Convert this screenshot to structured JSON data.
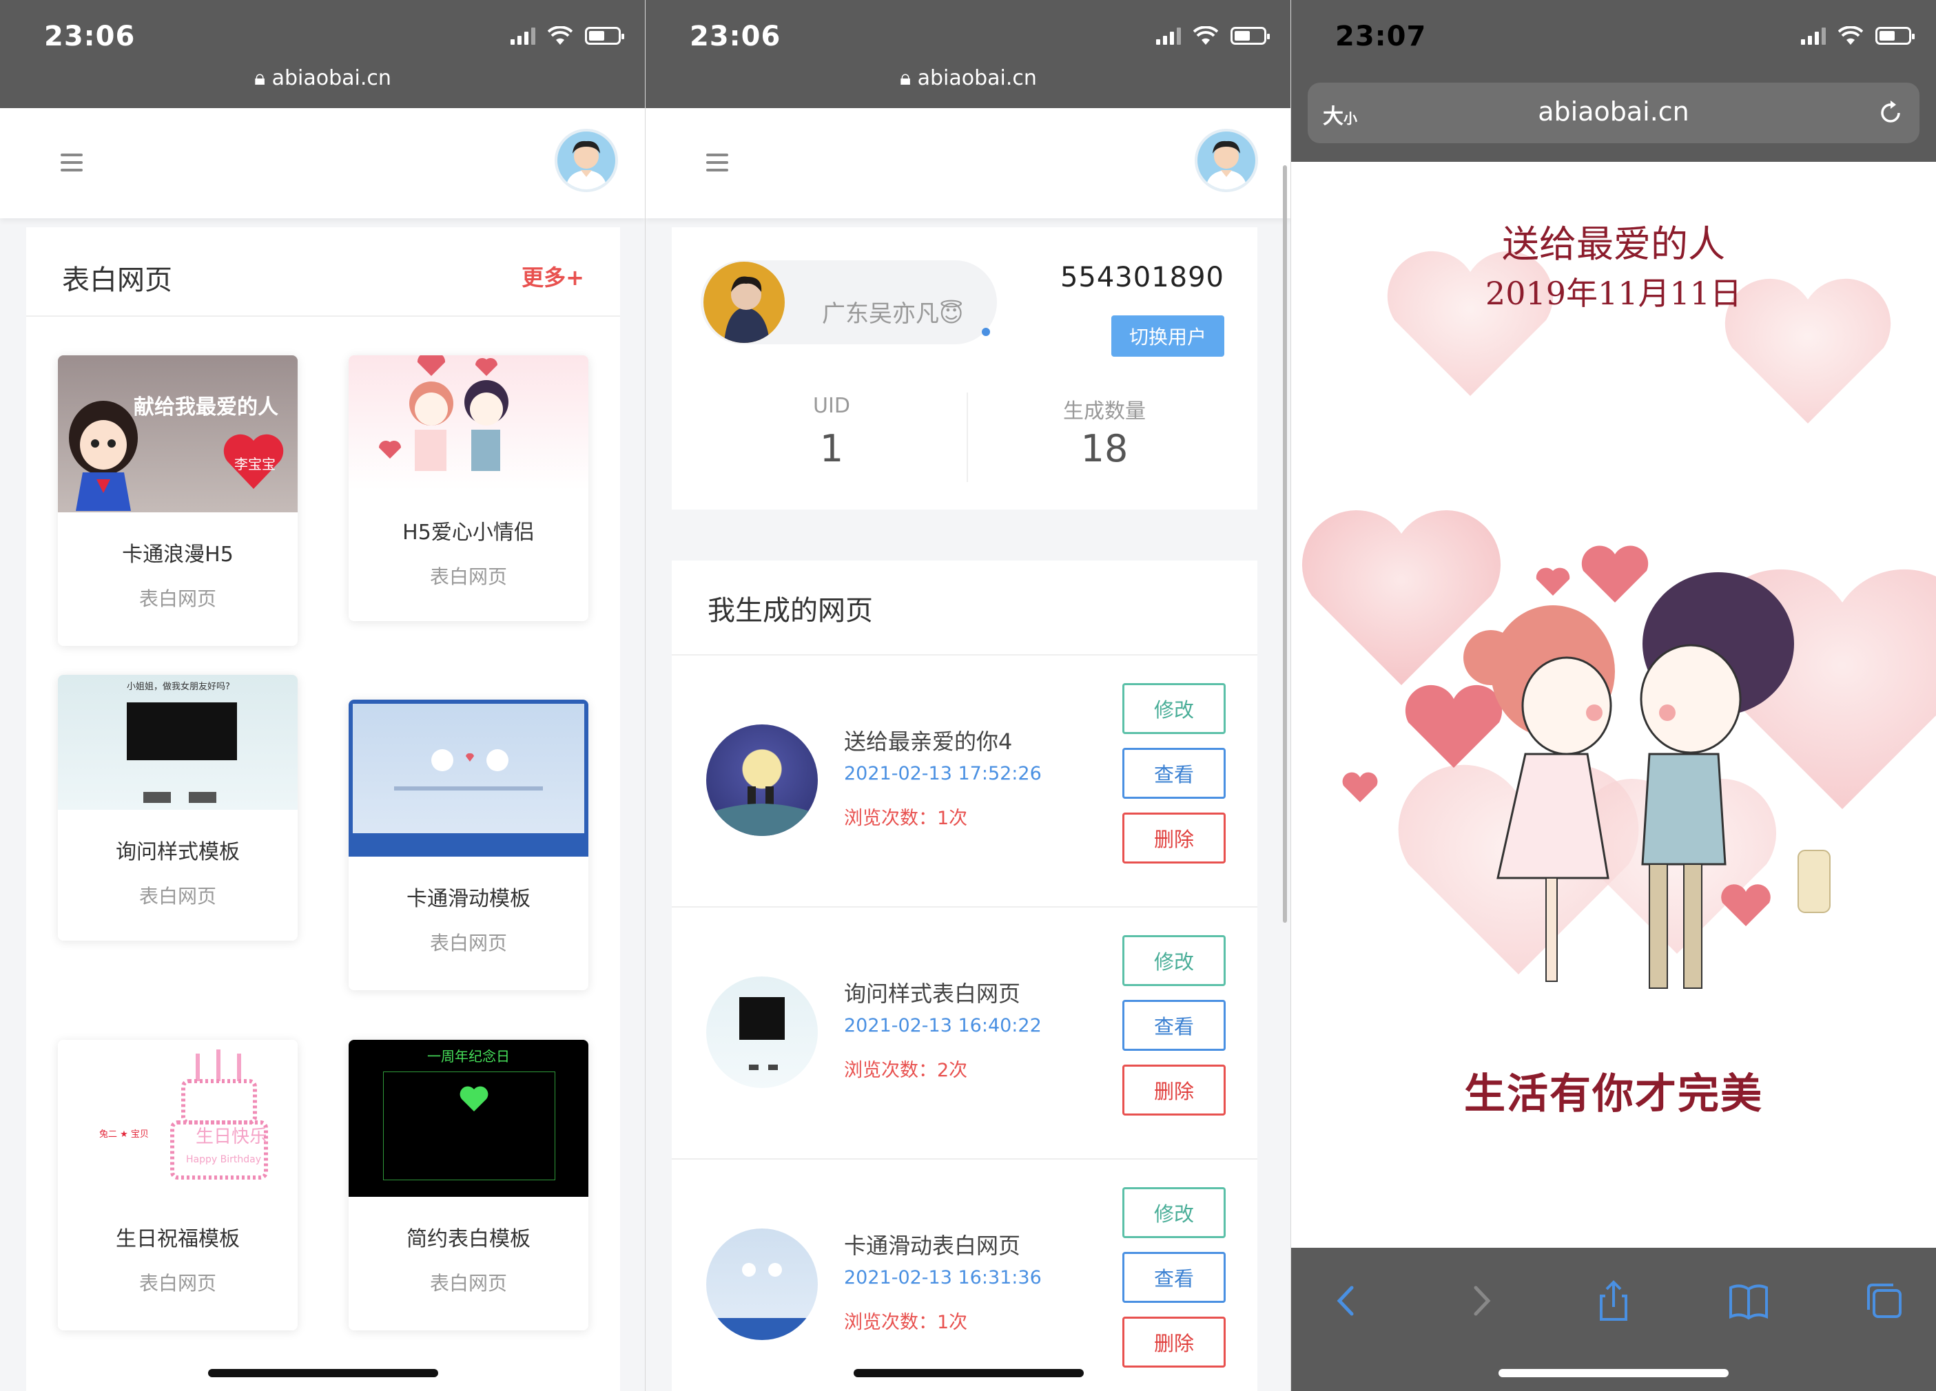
{
  "screens": {
    "s1": {
      "time": "23:06",
      "url": "abiaobai.cn",
      "section_title": "表白网页",
      "more_label": "更多+",
      "templates": [
        {
          "name": "卡通浪漫H5",
          "category": "表白网页",
          "thumb_text": "献给我最爱的人",
          "thumb_badge": "李宝宝"
        },
        {
          "name": "H5爱心小情侣",
          "category": "表白网页"
        },
        {
          "name": "询问样式模板",
          "category": "表白网页",
          "thumb_text": "小姐姐，做我女朋友好吗?"
        },
        {
          "name": "卡通滑动模板",
          "category": "表白网页"
        },
        {
          "name": "生日祝福模板",
          "category": "表白网页",
          "thumb_text": "生日快乐",
          "thumb_sub": "Happy Birthday",
          "thumb_name": "兔二 ★ 宝贝"
        },
        {
          "name": "简约表白模板",
          "category": "表白网页",
          "thumb_text": "一周年纪念日"
        }
      ]
    },
    "s2": {
      "time": "23:06",
      "url": "abiaobai.cn",
      "profile": {
        "name": "广东吴亦凡😇",
        "account": "554301890",
        "switch_label": "切换用户"
      },
      "stats": [
        {
          "label": "UID",
          "value": "1"
        },
        {
          "label": "生成数量",
          "value": "18"
        }
      ],
      "my_pages_title": "我生成的网页",
      "pages": [
        {
          "title": "送给最亲爱的你4",
          "date": "2021-02-13 17:52:26",
          "views": "浏览次数：1次"
        },
        {
          "title": "询问样式表白网页",
          "date": "2021-02-13 16:40:22",
          "views": "浏览次数：2次"
        },
        {
          "title": "卡通滑动表白网页",
          "date": "2021-02-13 16:31:36",
          "views": "浏览次数：1次"
        }
      ],
      "actions": {
        "edit": "修改",
        "view": "查看",
        "delete": "删除"
      }
    },
    "s3": {
      "time": "23:07",
      "aa_label": "大",
      "aa_small": "小",
      "url": "abiaobai.cn",
      "title": "送给最爱的人",
      "date": "2019年11月11日",
      "bottom_text": "生活有你才完美"
    }
  },
  "colors": {
    "accent_red": "#e8514f",
    "link_blue": "#4a90e2",
    "edit_green": "#5bc0a8",
    "maroon": "#8c1c2c"
  }
}
